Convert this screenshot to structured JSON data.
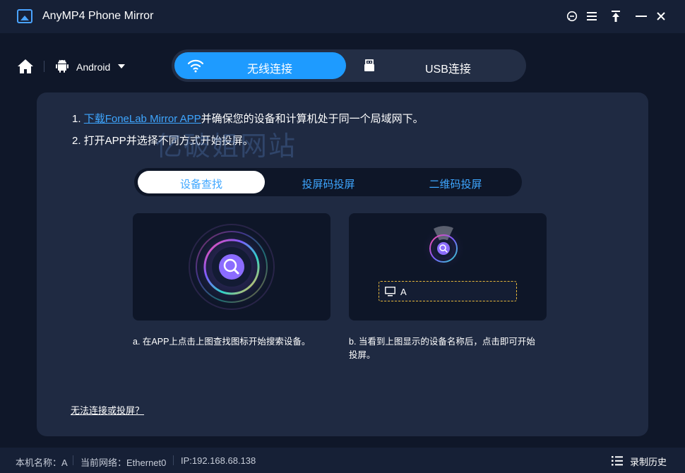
{
  "window": {
    "title": "AnyMP4 Phone Mirror"
  },
  "titlebar_icons": [
    "feedback-icon",
    "menu-icon",
    "pin-icon",
    "minimize-icon",
    "close-icon"
  ],
  "nav": {
    "device_type": "Android"
  },
  "connection_tabs": [
    {
      "label": "无线连接",
      "icon": "wifi-icon",
      "active": true
    },
    {
      "label": "USB连接",
      "icon": "usb-icon",
      "active": false
    }
  ],
  "instructions": {
    "line1_prefix": "1. ",
    "line1_link": "下载FoneLab Mirror APP",
    "line1_suffix": "并确保您的设备和计算机处于同一个局域网下。",
    "line2": "2. 打开APP并选择不同方式开始投屏。"
  },
  "watermark": "亿破姐网站",
  "mode_tabs": [
    {
      "label": "设备查找",
      "active": true
    },
    {
      "label": "投屏码投屏",
      "active": false
    },
    {
      "label": "二维码投屏",
      "active": false
    }
  ],
  "device_entry": {
    "name": "A"
  },
  "captions": {
    "a": "a. 在APP上点击上图查找图标开始搜索设备。",
    "b_line1": "b. 当看到上图显示的设备名称后，点击即可开始",
    "b_line2": "投屏。"
  },
  "help_link": "无法连接或投屏？",
  "status": {
    "local_name": "本机名称：A",
    "network": "当前网络：Ethernet0",
    "ip": "IP:192.168.68.138",
    "history": "录制历史"
  },
  "colors": {
    "accent": "#1e9bff",
    "link": "#3ea6ff",
    "panel": "#1f2a42",
    "background": "#0f1729",
    "device_border": "#e8b83a"
  }
}
